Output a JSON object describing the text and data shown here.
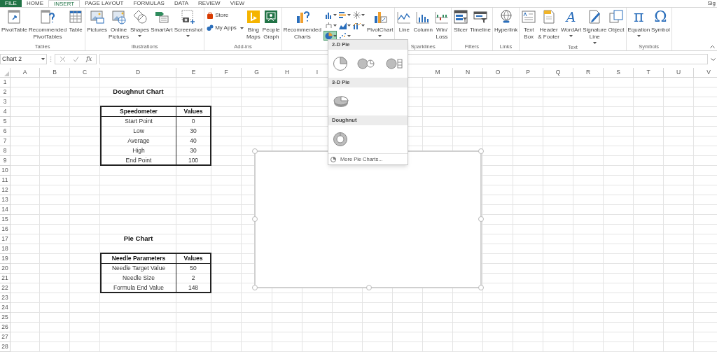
{
  "tabs": [
    {
      "label": "FILE",
      "kind": "file",
      "selected": false
    },
    {
      "label": "HOME",
      "kind": "tab",
      "selected": false
    },
    {
      "label": "INSERT",
      "kind": "tab",
      "selected": true
    },
    {
      "label": "PAGE LAYOUT",
      "kind": "tab",
      "selected": false
    },
    {
      "label": "FORMULAS",
      "kind": "tab",
      "selected": false
    },
    {
      "label": "DATA",
      "kind": "tab",
      "selected": false
    },
    {
      "label": "REVIEW",
      "kind": "tab",
      "selected": false
    },
    {
      "label": "VIEW",
      "kind": "tab",
      "selected": false
    }
  ],
  "account": "Sig",
  "ribbon": {
    "groups": [
      {
        "label": "Tables",
        "items": [
          {
            "kind": "large",
            "lines": [
              "PivotTable"
            ],
            "menu": false
          },
          {
            "kind": "large",
            "lines": [
              "Recommended",
              "PivotTables"
            ],
            "menu": false
          },
          {
            "kind": "large",
            "lines": [
              "Table"
            ],
            "menu": false
          }
        ]
      },
      {
        "label": "Illustrations",
        "items": [
          {
            "kind": "large",
            "lines": [
              "Pictures"
            ],
            "menu": false
          },
          {
            "kind": "large",
            "lines": [
              "Online",
              "Pictures"
            ],
            "menu": false
          },
          {
            "kind": "large",
            "lines": [
              "Shapes"
            ],
            "menu": true
          },
          {
            "kind": "large",
            "lines": [
              "SmartArt"
            ],
            "menu": false
          },
          {
            "kind": "large",
            "lines": [
              "Screenshot"
            ],
            "menu": true
          }
        ]
      },
      {
        "label": "Add-ins",
        "items": [
          {
            "kind": "stack",
            "entries": [
              {
                "label": "Store",
                "menu": false
              },
              {
                "label": "My Apps",
                "menu": true
              }
            ]
          },
          {
            "kind": "large",
            "lines": [
              "Bing",
              "Maps"
            ],
            "menu": false
          },
          {
            "kind": "large",
            "lines": [
              "People",
              "Graph"
            ],
            "menu": false
          }
        ]
      },
      {
        "items": [
          {
            "kind": "large",
            "lines": [
              "Recommended",
              "Charts"
            ],
            "menu": false
          },
          {
            "kind": "gallery",
            "entries": [
              {
                "selected": false
              },
              {
                "selected": false
              },
              {
                "selected": false
              },
              {
                "selected": false
              },
              {
                "selected": false
              },
              {
                "selected": false
              },
              {
                "selected": true
              },
              {
                "selected": false
              }
            ]
          },
          {
            "kind": "large",
            "lines": [
              "PivotChart"
            ],
            "menu": true
          }
        ]
      },
      {
        "label": "Sparklines",
        "items": [
          {
            "kind": "large",
            "lines": [
              "Line"
            ],
            "menu": false
          },
          {
            "kind": "large",
            "lines": [
              "Column"
            ],
            "menu": false
          },
          {
            "kind": "large",
            "lines": [
              "Win/",
              "Loss"
            ],
            "menu": false
          }
        ]
      },
      {
        "label": "Filters",
        "items": [
          {
            "kind": "large",
            "lines": [
              "Slicer"
            ],
            "menu": false
          },
          {
            "kind": "large",
            "lines": [
              "Timeline"
            ],
            "menu": false
          }
        ]
      },
      {
        "label": "Links",
        "items": [
          {
            "kind": "large",
            "lines": [
              "Hyperlink"
            ],
            "menu": false
          }
        ]
      },
      {
        "label": "Text",
        "items": [
          {
            "kind": "large",
            "lines": [
              "Text",
              "Box"
            ],
            "menu": false
          },
          {
            "kind": "large",
            "lines": [
              "Header",
              "& Footer"
            ],
            "menu": false
          },
          {
            "kind": "large",
            "glyph": "A",
            "lines": [
              "WordArt"
            ],
            "menu": true
          },
          {
            "kind": "large",
            "lines": [
              "Signature",
              "Line"
            ],
            "menu": true
          },
          {
            "kind": "large",
            "lines": [
              "Object"
            ],
            "menu": false
          }
        ]
      },
      {
        "label": "Symbols",
        "items": [
          {
            "kind": "large",
            "glyph": "π",
            "lines": [
              "Equation"
            ],
            "menu": true
          },
          {
            "kind": "large",
            "glyph": "Ω",
            "lines": [
              "Symbol"
            ],
            "menu": false
          }
        ]
      }
    ]
  },
  "formula_bar": {
    "name_box": "Chart 2",
    "fx": "fx"
  },
  "sheet": {
    "columns": [
      "A",
      "B",
      "C",
      "D",
      "E",
      "F",
      "G",
      "H",
      "I",
      "M",
      "N",
      "O",
      "P",
      "Q",
      "R",
      "S",
      "T",
      "U",
      "V"
    ],
    "rows": [
      "1",
      "2",
      "3",
      "4",
      "5",
      "6",
      "7",
      "8",
      "9",
      "10",
      "11",
      "12",
      "13",
      "14",
      "15",
      "16",
      "17",
      "18",
      "19",
      "20",
      "21",
      "22",
      "23",
      "24",
      "25",
      "26",
      "27",
      "28"
    ],
    "tables": [
      {
        "title": "Doughnut Chart",
        "header": [
          "Speedometer",
          "Values"
        ],
        "rows": [
          [
            "Start Point",
            "0"
          ],
          [
            "Low",
            "30"
          ],
          [
            "Average",
            "40"
          ],
          [
            "High",
            "30"
          ],
          [
            "End Point",
            "100"
          ]
        ]
      },
      {
        "title": "Pie Chart",
        "header": [
          "Needle Parameters",
          "Values"
        ],
        "rows": [
          [
            "Needle Target Value",
            "50"
          ],
          [
            "Needle Size",
            "2"
          ],
          [
            "Formula End Value",
            "148"
          ]
        ]
      }
    ]
  },
  "chart_object": {
    "selected": true
  },
  "pie_menu": {
    "sections": [
      {
        "title": "2-D Pie",
        "options": [
          {
            "kind": "pie"
          },
          {
            "kind": "pie-of-pie"
          },
          {
            "kind": "bar-of-pie"
          }
        ]
      },
      {
        "title": "3-D Pie",
        "options": [
          {
            "kind": "pie-3d"
          }
        ]
      },
      {
        "title": "Doughnut",
        "options": [
          {
            "kind": "doughnut"
          }
        ]
      }
    ],
    "more": "More Pie Charts..."
  }
}
